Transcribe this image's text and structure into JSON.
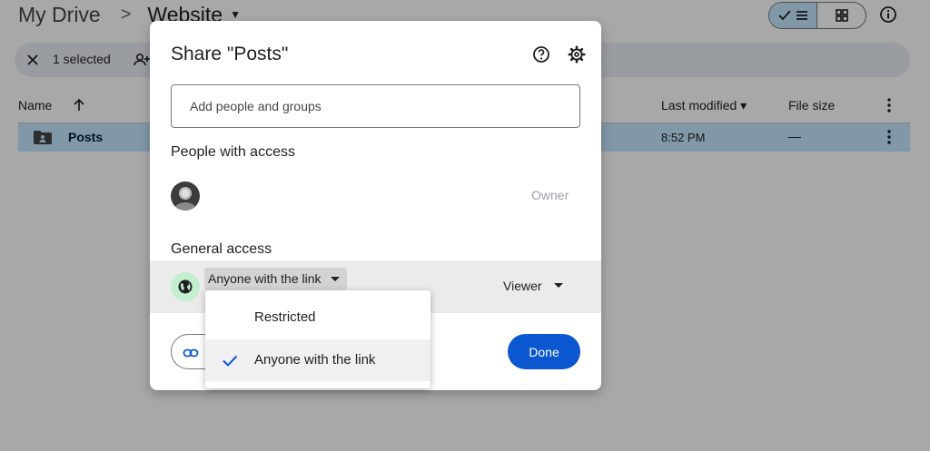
{
  "breadcrumb": {
    "root": "My Drive",
    "separator": ">",
    "current": "Website"
  },
  "selection": {
    "count_label": "1 selected"
  },
  "table": {
    "headers": {
      "name": "Name",
      "last_modified": "Last modified",
      "file_size": "File size"
    },
    "rows": [
      {
        "name": "Posts",
        "last_modified": "8:52 PM",
        "file_size": "—"
      }
    ]
  },
  "dialog": {
    "title": "Share \"Posts\"",
    "add_people_placeholder": "Add people and groups",
    "people_heading": "People with access",
    "people": [
      {
        "role": "Owner"
      }
    ],
    "general_heading": "General access",
    "general_access": {
      "value": "Anyone with the link",
      "role": "Viewer"
    },
    "done_label": "Done"
  },
  "access_menu": {
    "options": [
      {
        "label": "Restricted",
        "selected": false
      },
      {
        "label": "Anyone with the link",
        "selected": true
      }
    ]
  },
  "colors": {
    "accent": "#0b57d0",
    "selected_row": "#c2e7ff",
    "globe_bg": "#c4eed0",
    "scrim": "rgba(0,0,0,0.34)"
  },
  "icons": [
    "close-icon",
    "add-person-icon",
    "arrow-up-icon",
    "more-vert-icon",
    "folder-icon",
    "help-icon",
    "gear-icon",
    "globe-icon",
    "link-icon",
    "check-icon",
    "list-icon",
    "grid-icon",
    "info-icon"
  ]
}
